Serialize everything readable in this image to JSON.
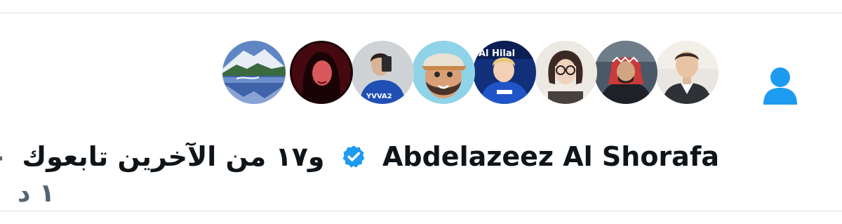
{
  "notification": {
    "icon": "person-icon",
    "accent_color": "#1d9bf0",
    "verified_color": "#1d9bf0",
    "name": "Abdelazeez Al Shorafa",
    "summary": "و١٧ من الآخرين تابعوك",
    "separator": "·",
    "time": "١ د"
  },
  "avatars": [
    {
      "name": "avatar-1",
      "description": "mountain landscape"
    },
    {
      "name": "avatar-2"
    },
    {
      "name": "avatar-3"
    },
    {
      "name": "avatar-4"
    },
    {
      "name": "avatar-5"
    },
    {
      "name": "avatar-6"
    },
    {
      "name": "avatar-7"
    },
    {
      "name": "avatar-8"
    }
  ]
}
